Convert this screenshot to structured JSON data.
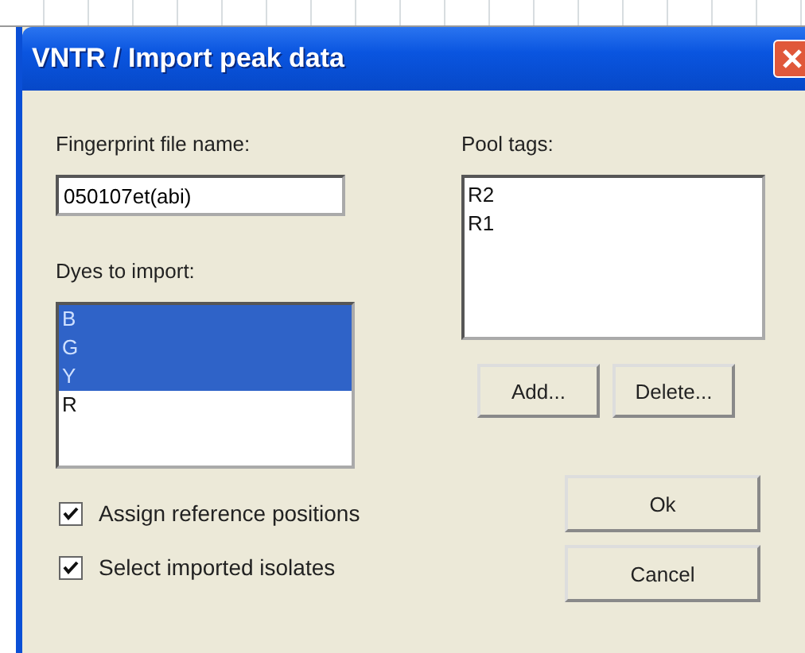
{
  "window": {
    "title": "VNTR / Import peak data"
  },
  "fingerprint_file": {
    "label": "Fingerprint file name:",
    "value": "050107et(abi)"
  },
  "dyes": {
    "label": "Dyes to import:",
    "items": [
      {
        "label": "B",
        "selected": true
      },
      {
        "label": "G",
        "selected": true
      },
      {
        "label": "Y",
        "selected": true
      },
      {
        "label": "R",
        "selected": false
      }
    ]
  },
  "options": [
    {
      "label": "Assign reference positions",
      "checked": true
    },
    {
      "label": "Select imported isolates",
      "checked": true
    }
  ],
  "pool_tags": {
    "label": "Pool tags:",
    "items": [
      {
        "label": "R2"
      },
      {
        "label": "R1"
      }
    ]
  },
  "tag_buttons": [
    "Add...",
    "Delete..."
  ],
  "buttons": [
    "Ok",
    "Cancel"
  ]
}
